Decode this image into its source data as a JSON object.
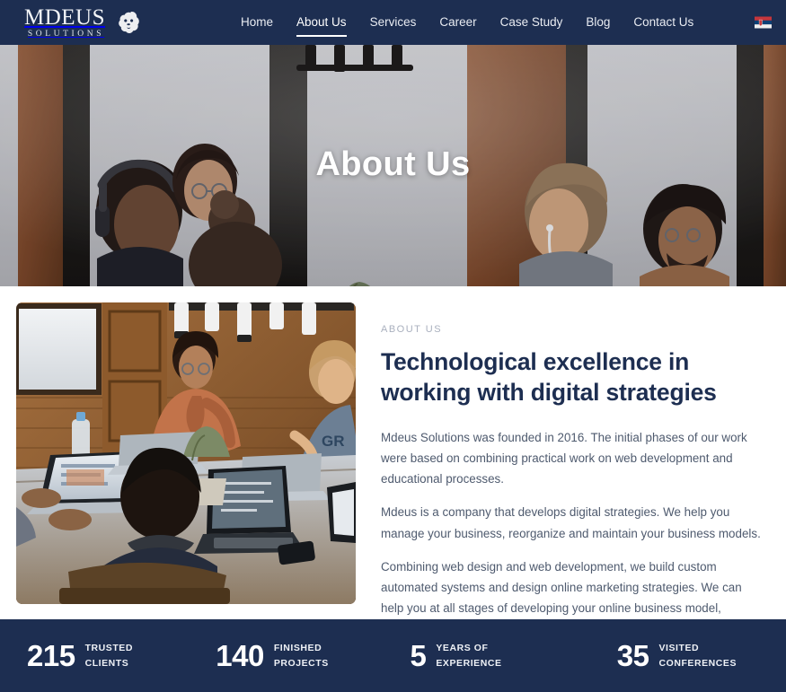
{
  "colors": {
    "brand_navy": "#1d2e51",
    "heading": "#1d2e51",
    "body_text": "#4e5a6e",
    "eyebrow": "#a9b0be",
    "white": "#ffffff"
  },
  "header": {
    "logo": {
      "main": "MDEUS",
      "sub": "SOLUTIONS",
      "icon": "lion-head-icon"
    },
    "nav": [
      {
        "label": "Home",
        "active": false
      },
      {
        "label": "About Us",
        "active": true
      },
      {
        "label": "Services",
        "active": false
      },
      {
        "label": "Career",
        "active": false
      },
      {
        "label": "Case Study",
        "active": false
      },
      {
        "label": "Blog",
        "active": false
      },
      {
        "label": "Contact Us",
        "active": false
      }
    ],
    "language": {
      "icon": "serbian-flag-icon",
      "label": "Serbian"
    }
  },
  "hero": {
    "title": "About Us",
    "image_alt": "people working together in a coworking space"
  },
  "about": {
    "image_alt": "team working on laptops around a wooden table",
    "eyebrow": "ABOUT US",
    "heading": "Technological excellence in working with digital strategies",
    "paragraphs": [
      "Mdeus Solutions was founded in 2016. The initial phases of our work were based on combining practical work on web development and educational processes.",
      "Mdeus is a company that develops digital strategies. We help you manage your business, reorganize and maintain your business models.",
      "Combining web design and web development, we build custom automated systems and design online marketing strategies. We can help you at all stages of developing your online business model, designing your sites and organizing web platforms. If you have business ideas, we are ready to help you with their implementation and development."
    ]
  },
  "stats": [
    {
      "number": "215",
      "label": "Trusted Clients"
    },
    {
      "number": "140",
      "label": "Finished Projects"
    },
    {
      "number": "5",
      "label": "Years of Experience"
    },
    {
      "number": "35",
      "label": "Visited Conferences"
    }
  ]
}
